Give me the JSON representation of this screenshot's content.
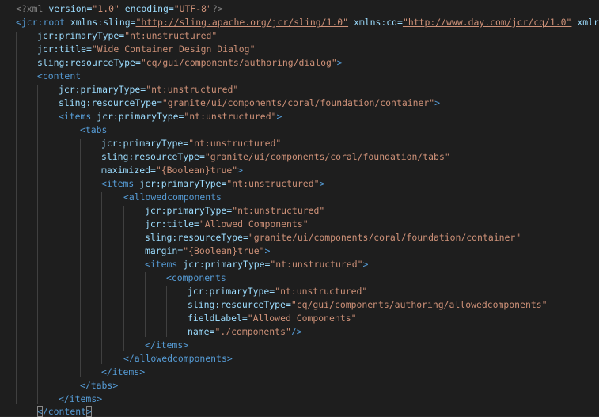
{
  "editor": {
    "xml_decl": {
      "open": "<?xml",
      "version_attr": "version=",
      "version_val": "\"1.0\"",
      "encoding_attr": "encoding=",
      "encoding_val": "\"UTF-8\"",
      "close": "?>"
    },
    "root": {
      "open": "<jcr:root",
      "xmlns_sling_attr": "xmlns:sling=",
      "xmlns_sling_val": "\"http://sling.apache.org/jcr/sling/1.0\"",
      "xmlns_cq_attr": "xmlns:cq=",
      "xmlns_cq_val": "\"http://www.day.com/jcr/cq/1.0\"",
      "xmlns_more": "xmlr",
      "attrs": [
        {
          "name": "jcr:primaryType=",
          "value": "\"nt:unstructured\""
        },
        {
          "name": "jcr:title=",
          "value": "\"Wide Container Design Dialog\""
        },
        {
          "name": "sling:resourceType=",
          "value": "\"cq/gui/components/authoring/dialog\"",
          "tail": ">"
        }
      ]
    },
    "content": {
      "open": "<content",
      "attrs": [
        {
          "name": "jcr:primaryType=",
          "value": "\"nt:unstructured\""
        },
        {
          "name": "sling:resourceType=",
          "value": "\"granite/ui/components/coral/foundation/container\"",
          "tail": ">"
        }
      ],
      "close_lt": "<",
      "close_rest": "/content",
      "close_gt": ">"
    },
    "items1": {
      "open": "<items",
      "attr": "jcr:primaryType=",
      "value": "\"nt:unstructured\"",
      "tail": ">",
      "close": "</items>"
    },
    "tabs": {
      "open": "<tabs",
      "attrs": [
        {
          "name": "jcr:primaryType=",
          "value": "\"nt:unstructured\""
        },
        {
          "name": "sling:resourceType=",
          "value": "\"granite/ui/components/coral/foundation/tabs\""
        },
        {
          "name": "maximized=",
          "value": "\"{Boolean}true\"",
          "tail": ">"
        }
      ],
      "close": "</tabs>"
    },
    "items2": {
      "open": "<items",
      "attr": "jcr:primaryType=",
      "value": "\"nt:unstructured\"",
      "tail": ">",
      "close": "</items>"
    },
    "allowedcomponents": {
      "open": "<allowedcomponents",
      "attrs": [
        {
          "name": "jcr:primaryType=",
          "value": "\"nt:unstructured\""
        },
        {
          "name": "jcr:title=",
          "value": "\"Allowed Components\""
        },
        {
          "name": "sling:resourceType=",
          "value": "\"granite/ui/components/coral/foundation/container\""
        },
        {
          "name": "margin=",
          "value": "\"{Boolean}true\"",
          "tail": ">"
        }
      ],
      "close": "</allowedcomponents>"
    },
    "items3": {
      "open": "<items",
      "attr": "jcr:primaryType=",
      "value": "\"nt:unstructured\"",
      "tail": ">",
      "close": "</items>"
    },
    "components": {
      "open": "<components",
      "attrs": [
        {
          "name": "jcr:primaryType=",
          "value": "\"nt:unstructured\""
        },
        {
          "name": "sling:resourceType=",
          "value": "\"cq/gui/components/authoring/allowedcomponents\""
        },
        {
          "name": "fieldLabel=",
          "value": "\"Allowed Components\""
        },
        {
          "name": "name=",
          "value": "\"./components\"",
          "tail": "/>"
        }
      ]
    }
  }
}
